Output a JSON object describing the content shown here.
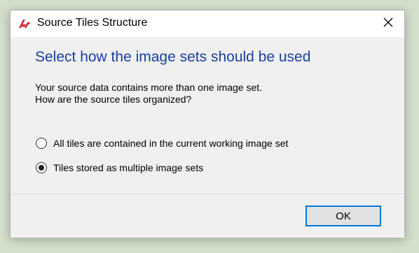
{
  "window": {
    "title": "Source Tiles Structure",
    "app_icon": "source-tiles-app-icon",
    "close_icon": "close-icon"
  },
  "main": {
    "instruction": "Select how the image sets should be used",
    "description_line1": "Your source data contains more than one image set.",
    "description_line2": "How are the source tiles organized?",
    "options": [
      {
        "label": "All tiles are contained in the current working image set",
        "selected": false
      },
      {
        "label": "Tiles stored as multiple image sets",
        "selected": true
      }
    ]
  },
  "footer": {
    "ok_label": "OK"
  },
  "colors": {
    "instruction_text": "#1a3fa0",
    "content_background": "#f0f0f0",
    "focus_border": "#0078d7",
    "app_icon_red": "#d71920",
    "desktop_background": "#d4e0cb"
  }
}
